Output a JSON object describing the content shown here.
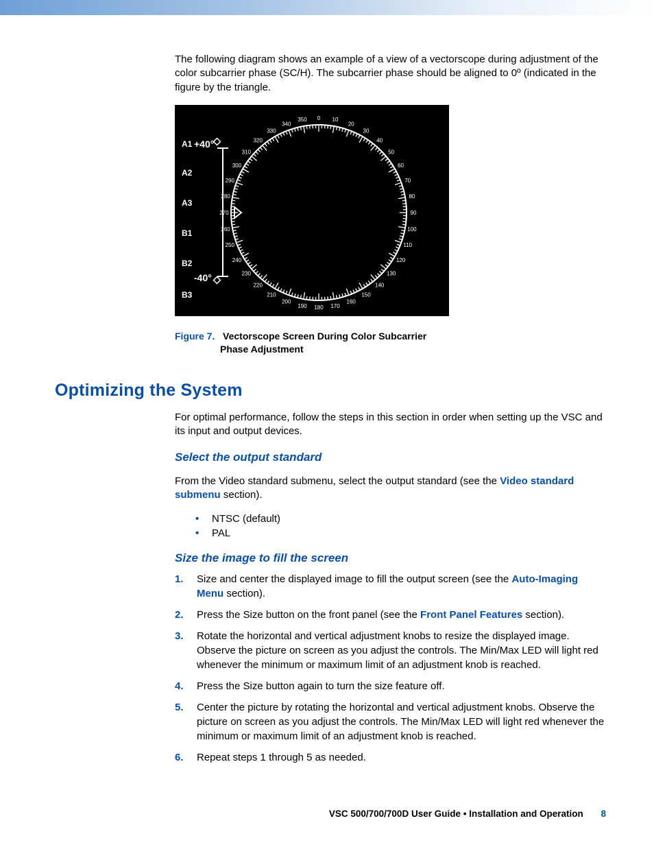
{
  "intro": "The following diagram shows an example of a view of a vectorscope during adjustment of the color subcarrier phase (SC/H). The subcarrier phase should be aligned to 0º (indicated in the figure by the triangle.",
  "figure": {
    "label": "Figure 7.",
    "title_line1": "Vectorscope  Screen During Color Subcarrier",
    "title_line2": "Phase Adjustment",
    "side_labels": [
      "A1",
      "A2",
      "A3",
      "B1",
      "B2",
      "B3"
    ],
    "plus40": "+40°",
    "minus40": "-40°",
    "ticks": [
      0,
      10,
      20,
      30,
      40,
      50,
      60,
      70,
      80,
      90,
      100,
      110,
      120,
      130,
      140,
      150,
      160,
      170,
      180,
      190,
      200,
      210,
      220,
      230,
      240,
      250,
      260,
      270,
      280,
      290,
      300,
      310,
      320,
      330,
      340,
      350
    ]
  },
  "section_title": "Optimizing the System",
  "section_intro": "For optimal performance, follow the steps in this section in order when setting up the VSC and its input and output devices.",
  "subs": {
    "select": {
      "title": "Select the output standard",
      "text_a": "From the Video standard submenu, select the output standard (see the ",
      "link": "Video standard submenu",
      "text_b": " section).",
      "bullets": [
        "NTSC (default)",
        "PAL"
      ]
    },
    "size": {
      "title": "Size the image to fill the screen",
      "steps": [
        {
          "pre": "Size and center the displayed image to fill the output screen (see the ",
          "link": "Auto-Imaging Menu",
          "post": " section)."
        },
        {
          "pre": "Press the Size button on the front panel (see the ",
          "link": "Front Panel Features",
          "post": " section)."
        },
        {
          "text": "Rotate the horizontal and vertical adjustment knobs to resize the displayed image. Observe the picture on screen as you adjust the controls. The Min/Max LED will light red whenever the minimum or maximum limit of an adjustment knob is reached."
        },
        {
          "text": "Press the Size button again to turn the size feature off."
        },
        {
          "text": "Center the picture by rotating the horizontal and vertical adjustment knobs. Observe the picture on screen as you adjust the controls. The Min/Max LED will light red whenever the minimum or maximum limit of an adjustment knob is reached."
        },
        {
          "text": "Repeat steps 1 through 5 as needed."
        }
      ]
    }
  },
  "footer": {
    "title": "VSC 500/700/700D User Guide • Installation and Operation",
    "page": "8"
  }
}
